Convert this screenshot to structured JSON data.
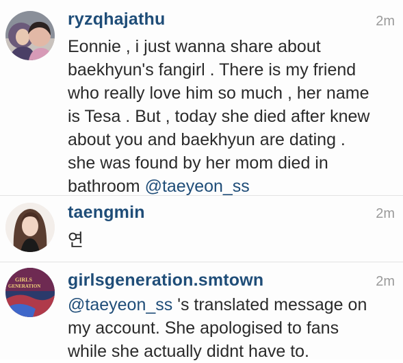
{
  "comments": [
    {
      "username": "ryzqhajathu",
      "time": "2m",
      "avatar_icon": "profile-photo-two-girls-hijab",
      "lines": [
        "Eonnie , i just wanna share about",
        "baekhyun's fangirl . There is my friend",
        "who really love him so much , her name",
        "is Tesa . But , today she died after knew",
        "about you and baekhyun are dating .",
        "she was found by her mom died in"
      ],
      "last_line_text": "bathroom ",
      "mention": "@taeyeon_ss"
    },
    {
      "username": "taengmin",
      "time": "2m",
      "avatar_icon": "profile-photo-girl-long-hair",
      "text": "연"
    },
    {
      "username": "girlsgeneration.smtown",
      "time": "2m",
      "avatar_icon": "girls-generation-album-cover",
      "avatar_text": [
        "GIRLS",
        "GENERATION"
      ],
      "mention": "@taeyeon_ss",
      "first_line_rest": " 's translated message on",
      "lines": [
        "my account. She apologised to fans",
        "while she actually didnt have to."
      ]
    }
  ],
  "colors": {
    "username": "#1f4d78",
    "mention": "#1f4d78",
    "body": "#2a2a2a",
    "timestamp": "#9a9a9a",
    "divider": "#e2e2e2"
  }
}
